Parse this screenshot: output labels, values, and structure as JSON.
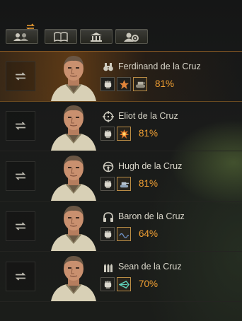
{
  "toolbar": {
    "buttons": [
      {
        "icon": "crew-swap-icon"
      },
      {
        "icon": "book-icon"
      },
      {
        "icon": "barracks-icon"
      },
      {
        "icon": "crew-settings-icon"
      }
    ]
  },
  "colors": {
    "accent": "#f2a033",
    "selected_row": "#8a5a24",
    "text": "#d7d4c8"
  },
  "crew": [
    {
      "role_icon": "binoculars-icon",
      "name": "Ferdinand de la Cruz",
      "percent": "81%",
      "selected": true,
      "skills": [
        "fist-icon",
        "commander-star-icon",
        "tank-tracks-icon"
      ]
    },
    {
      "role_icon": "crosshair-icon",
      "name": "Eliot de la Cruz",
      "percent": "81%",
      "selected": false,
      "skills": [
        "fist-icon",
        "explosion-icon"
      ]
    },
    {
      "role_icon": "steering-wheel-icon",
      "name": "Hugh de la Cruz",
      "percent": "81%",
      "selected": false,
      "skills": [
        "fist-icon",
        "tank-drive-icon"
      ]
    },
    {
      "role_icon": "headphones-icon",
      "name": "Baron de la Cruz",
      "percent": "64%",
      "selected": false,
      "skills": [
        "fist-icon",
        "radio-wave-icon"
      ]
    },
    {
      "role_icon": "ammo-icon",
      "name": "Sean de la Cruz",
      "percent": "70%",
      "selected": false,
      "skills": [
        "fist-icon",
        "shell-speed-icon"
      ]
    }
  ]
}
